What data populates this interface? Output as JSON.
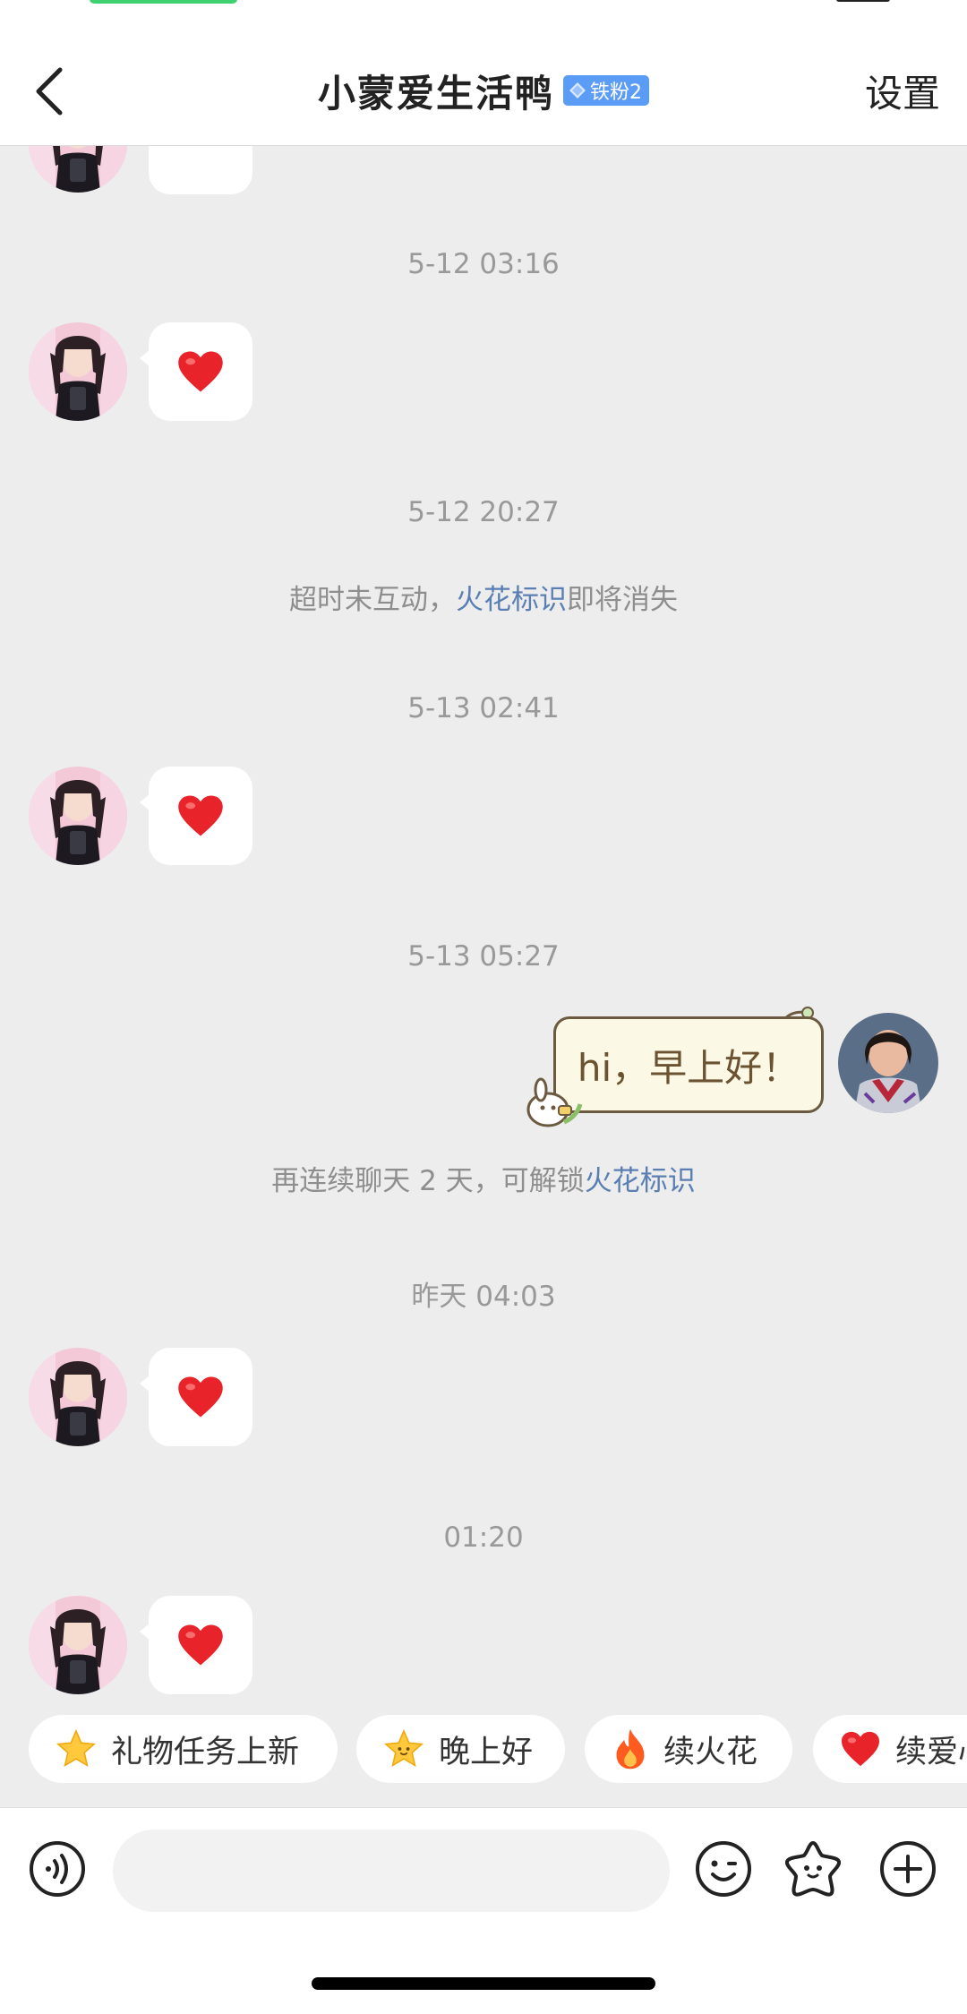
{
  "header": {
    "back_icon": "chevron-left-icon",
    "title": "小蒙爱生活鸭",
    "badge": "铁粉2",
    "settings_label": "设置"
  },
  "chat": {
    "timestamps": [
      "5-12 03:16",
      "5-12 20:27",
      "5-13 02:41",
      "5-13 05:27",
      "昨天 04:03",
      "01:20"
    ],
    "system_1": {
      "prefix": "超时未互动，",
      "link": "火花标识",
      "suffix": "即将消失"
    },
    "system_2": {
      "prefix": "再连续聊天 2 天，可解锁",
      "link": "火花标识"
    },
    "heart_message": "red-heart-emoji",
    "my_message": "hi，早上好！"
  },
  "quick_replies": [
    {
      "icon": "star-icon",
      "label": "礼物任务上新"
    },
    {
      "icon": "smiling-star-icon",
      "label": "晚上好"
    },
    {
      "icon": "fire-icon",
      "label": "续火花"
    },
    {
      "icon": "heart-icon",
      "label": "续爱心"
    }
  ],
  "input_bar": {
    "voice_icon": "voice-icon",
    "placeholder": "",
    "emoji_icon": "emoji-icon",
    "sticker_icon": "sticker-star-icon",
    "more_icon": "plus-circle-icon"
  },
  "colors": {
    "accent_link": "#5a7fb3",
    "badge": "#5b9cf6",
    "heart": "#e8232a"
  }
}
